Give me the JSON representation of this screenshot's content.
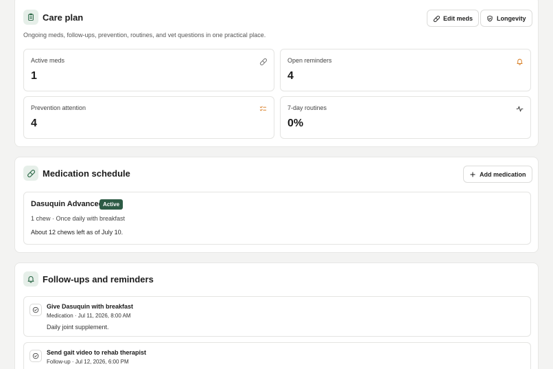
{
  "care_plan": {
    "title": "Care plan",
    "subtitle": "Ongoing meds, follow-ups, prevention, routines, and vet questions in one practical place.",
    "icon": "clipboard-icon",
    "buttons": {
      "edit_meds": "Edit meds",
      "longevity": "Longevity"
    },
    "stats": [
      {
        "label": "Active meds",
        "value": "1",
        "icon": "pill-icon",
        "icon_color": "#7a7a7a"
      },
      {
        "label": "Open reminders",
        "value": "4",
        "icon": "bell-icon",
        "icon_color": "#d9822b"
      },
      {
        "label": "Prevention attention",
        "value": "4",
        "icon": "checklist-icon",
        "icon_color": "#d9822b"
      },
      {
        "label": "7-day routines",
        "value": "0%",
        "icon": "activity-icon",
        "icon_color": "#444444"
      }
    ]
  },
  "medication_schedule": {
    "title": "Medication schedule",
    "icon": "pill-icon",
    "add_button": "Add medication",
    "meds": [
      {
        "name": "Dasuquin Advanced",
        "status": "Active",
        "dosage": "1 chew · Once daily with breakfast",
        "note": "About 12 chews left as of July 10."
      }
    ]
  },
  "follow_ups": {
    "title": "Follow-ups and reminders",
    "icon": "bell-icon",
    "items": [
      {
        "title": "Give Dasuquin with breakfast",
        "meta": "Medication · Jul 11, 2026, 8:00 AM",
        "note": "Daily joint supplement."
      },
      {
        "title": "Send gait video to rehab therapist",
        "meta": "Follow-up · Jul 12, 2026, 6:00 PM",
        "note": ""
      }
    ]
  },
  "colors": {
    "accent_green": "#2d5b45",
    "icon_bg": "#e6efe9",
    "warning_orange": "#d9822b"
  }
}
